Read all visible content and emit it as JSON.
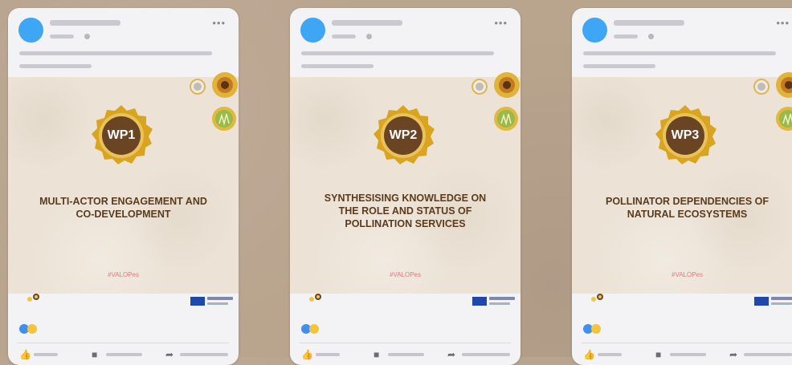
{
  "cards": [
    {
      "badge": "WP1",
      "title_lines": [
        "MULTI-ACTOR ENGAGEMENT AND",
        "CO-DEVELOPMENT"
      ],
      "hashtag": "#VALOPes"
    },
    {
      "badge": "WP2",
      "title_lines": [
        "SYNTHESISING KNOWLEDGE ON",
        "THE ROLE AND STATUS OF",
        "POLLINATION SERVICES"
      ],
      "hashtag": "#VALOPes"
    },
    {
      "badge": "WP3",
      "title_lines": [
        "POLLINATOR DEPENDENCIES OF",
        "NATURAL ECOSYSTEMS"
      ],
      "hashtag": "#VALOPes"
    }
  ],
  "header": {
    "more": "•••"
  },
  "icons": {
    "like": "thumbs-up-icon",
    "comment": "comment-icon",
    "share": "share-icon"
  },
  "colors": {
    "avatar": "#3fa5f5",
    "badge_gold": "#d9a520",
    "badge_brown": "#6b4423",
    "title": "#5a3b1f",
    "hashtag": "#e07a82",
    "reaction_blue": "#3f8ef0",
    "reaction_yellow": "#f4c43d"
  }
}
